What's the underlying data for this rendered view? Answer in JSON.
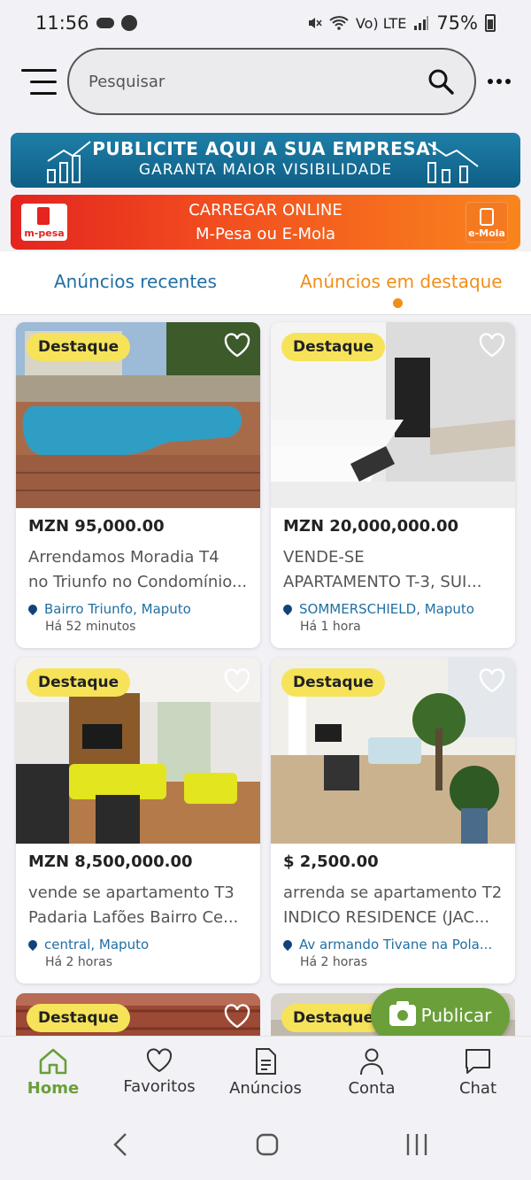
{
  "status_bar": {
    "time": "11:56",
    "battery": "75%",
    "network": "Vo) LTE"
  },
  "header": {
    "search_placeholder": "Pesquisar"
  },
  "banner_ad": {
    "line1": "PUBLICITE AQUI A SUA EMPRESA!",
    "line2": "GARANTA MAIOR VISIBILIDADE"
  },
  "banner_topup": {
    "line1": "CARREGAR ONLINE",
    "line2": "M-Pesa ou E-Mola",
    "logo_left": "m-pesa",
    "logo_right": "e-Mola"
  },
  "tabs": {
    "recent": "Anúncios recentes",
    "featured": "Anúncios em destaque",
    "active": "featured"
  },
  "listings": [
    {
      "badge": "Destaque",
      "price": "MZN 95,000.00",
      "title_line1": "Arrendamos Moradia T4",
      "title_line2": "no Triunfo no Condomínio...",
      "location": "Bairro Triunfo, Maputo",
      "time": "Há 52 minutos"
    },
    {
      "badge": "Destaque",
      "price": "MZN 20,000,000.00",
      "title_line1": "VENDE-SE",
      "title_line2": "APARTAMENTO T-3, SUI...",
      "location": "SOMMERSCHIELD, Maputo",
      "time": "Há 1 hora"
    },
    {
      "badge": "Destaque",
      "price": "MZN 8,500,000.00",
      "title_line1": "vende se apartamento T3",
      "title_line2": "Padaria Lafões Bairro Ce...",
      "location": "central, Maputo",
      "time": "Há 2 horas"
    },
    {
      "badge": "Destaque",
      "price": "$ 2,500.00",
      "title_line1": "arrenda se apartamento T2",
      "title_line2": "INDICO RESIDENCE (JAC...",
      "location": "Av armando Tivane na Pola...",
      "time": "Há 2 horas"
    },
    {
      "badge": "Destaque"
    },
    {
      "badge": "Destaque"
    }
  ],
  "publish_button": {
    "label": "Publicar"
  },
  "bottom_nav": {
    "items": [
      {
        "label": "Home",
        "icon": "home-icon"
      },
      {
        "label": "Favoritos",
        "icon": "heart-icon"
      },
      {
        "label": "Anúncios",
        "icon": "document-icon"
      },
      {
        "label": "Conta",
        "icon": "user-icon"
      },
      {
        "label": "Chat",
        "icon": "chat-icon"
      }
    ],
    "active": "Home"
  },
  "colors": {
    "accent_green": "#6a9f3a",
    "featured_orange": "#ef8f1a",
    "link_blue": "#1f6fa3",
    "badge_yellow": "#f6e35a"
  }
}
